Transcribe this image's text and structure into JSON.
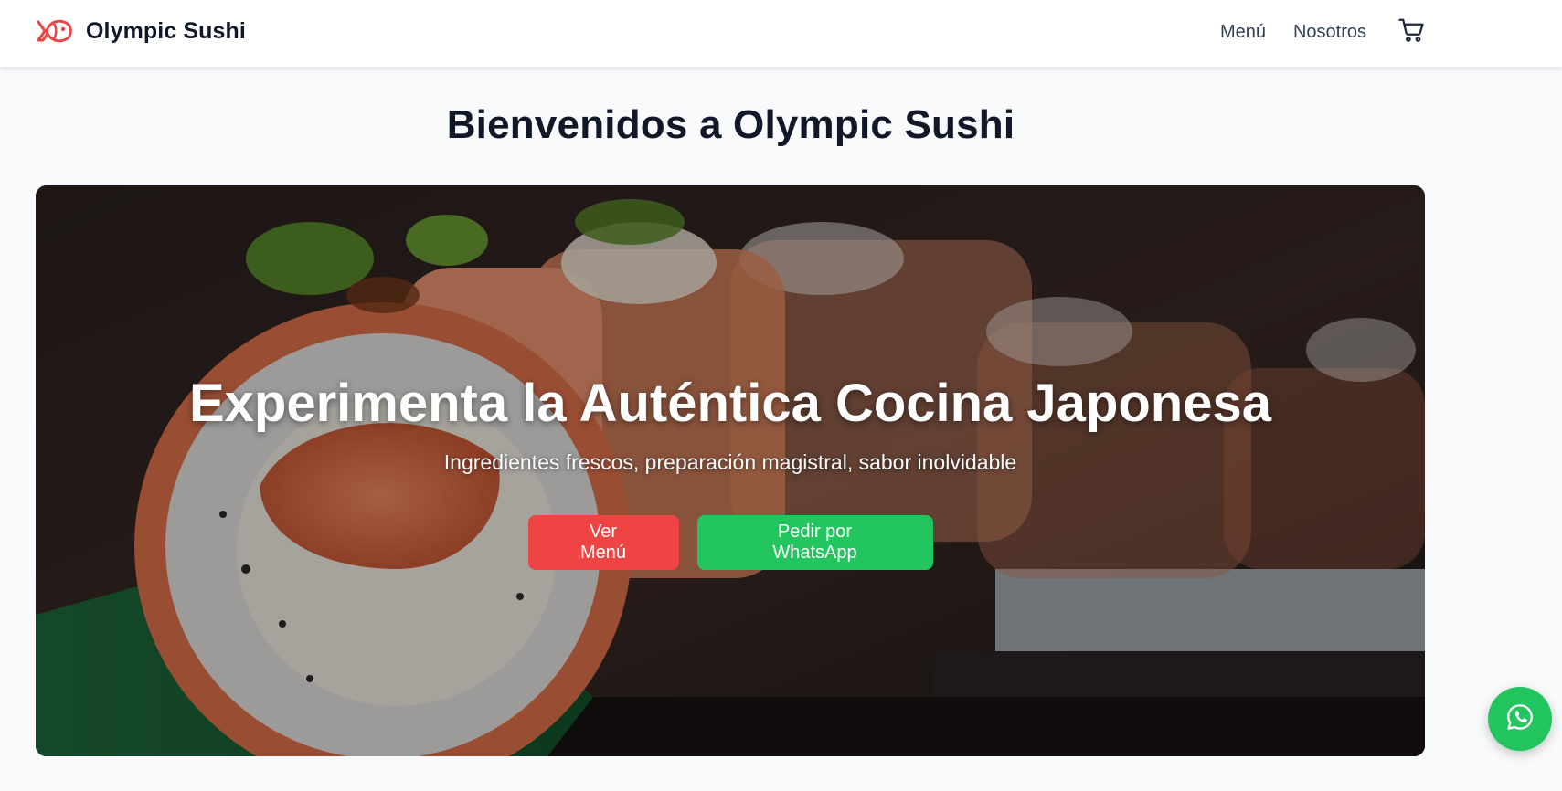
{
  "header": {
    "brand_name": "Olympic Sushi",
    "logo_icon": "fish-icon",
    "nav": [
      {
        "label": "Menú"
      },
      {
        "label": "Nosotros"
      }
    ],
    "cart_icon": "shopping-cart-icon"
  },
  "main": {
    "title": "Bienvenidos a Olympic Sushi"
  },
  "hero": {
    "headline": "Experimenta la Auténtica Cocina Japonesa",
    "subheadline": "Ingredientes frescos, preparación magistral, sabor inolvidable",
    "primary_button": "Ver Menú",
    "secondary_button": "Pedir por WhatsApp",
    "image_subject": "salmon sushi rolls on a plate"
  },
  "floating": {
    "whatsapp_icon": "whatsapp-icon"
  },
  "colors": {
    "brand_red": "#ef4444",
    "whatsapp_green": "#22c55e",
    "text_dark": "#0f172a",
    "page_bg": "#f8fafc"
  }
}
